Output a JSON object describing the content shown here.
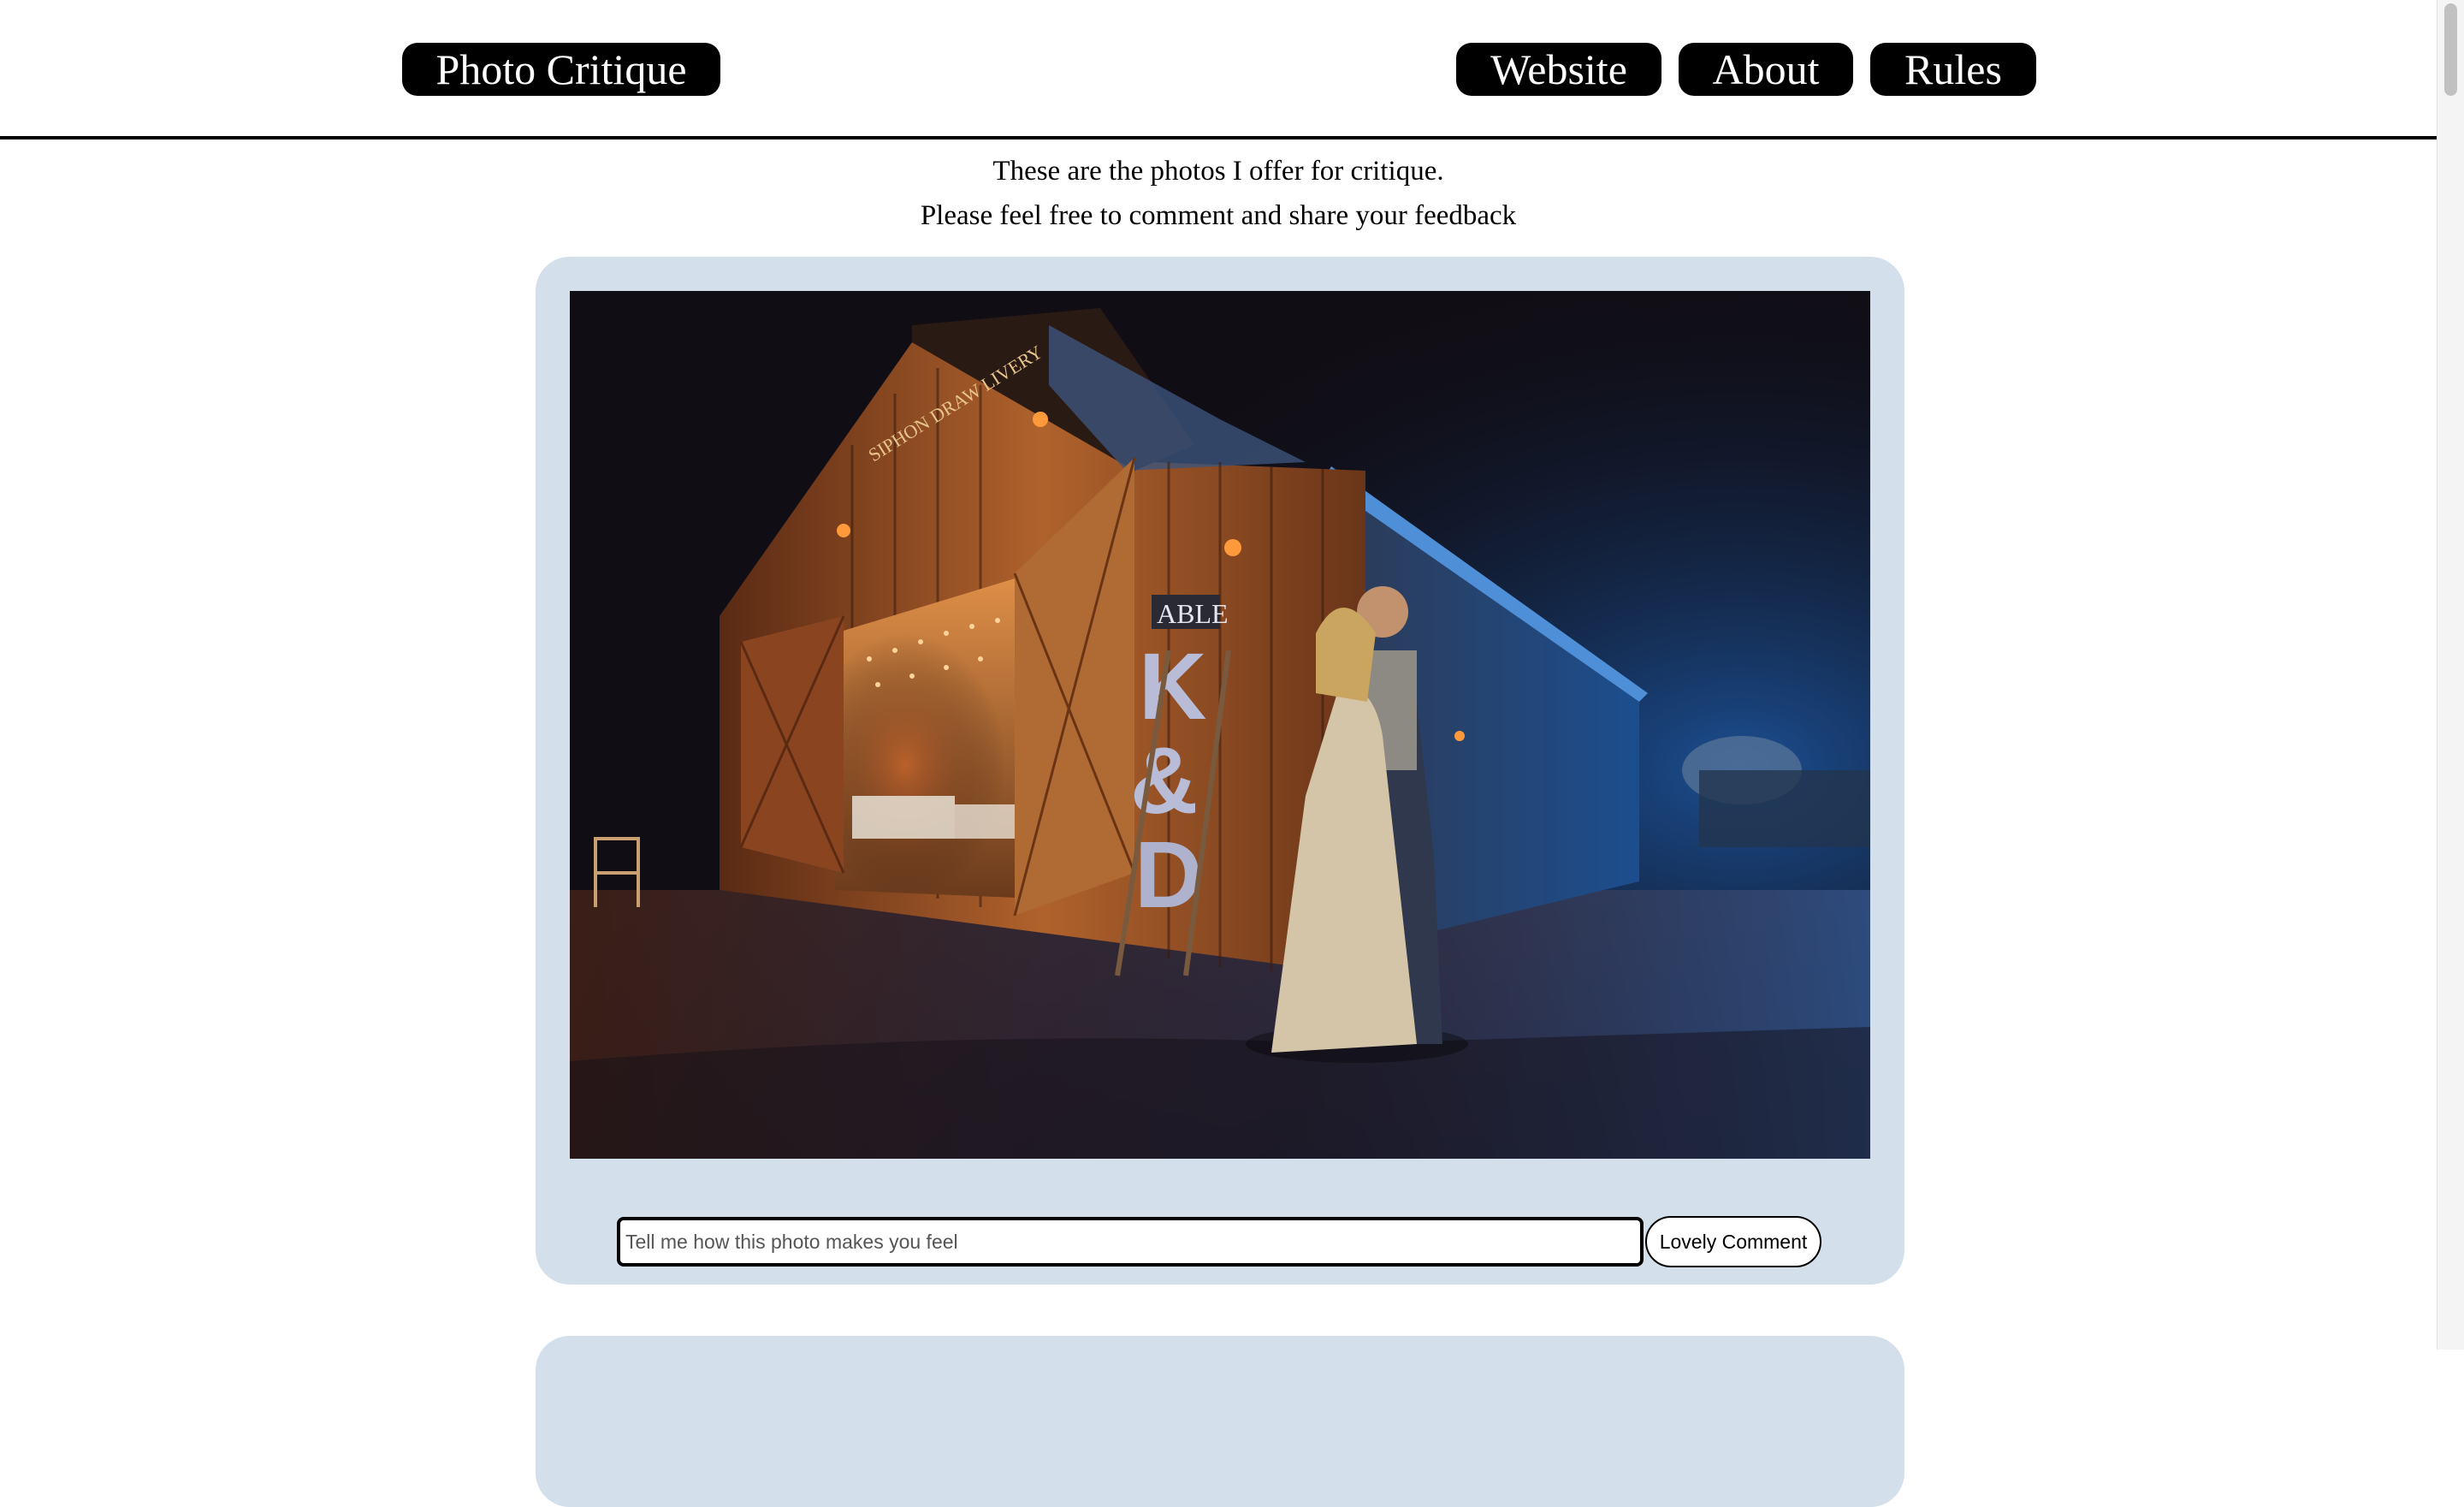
{
  "header": {
    "brand": "Photo Critique",
    "nav": {
      "website": "Website",
      "about": "About",
      "rules": "Rules"
    }
  },
  "intro": {
    "line1": "These are the photos I offer for critique.",
    "line2": "Please feel free to comment and share your feedback"
  },
  "posts": [
    {
      "photo": {
        "sign_text": "SIPHON DRAW LIVERY",
        "table_sign": "ABLE",
        "letters": "K & D"
      },
      "comment": {
        "placeholder": "Tell me how this photo makes you feel",
        "button_label": "Lovely Comment"
      }
    }
  ],
  "colors": {
    "card_bg": "#d4dfec",
    "pill_bg": "#000000",
    "page_bg": "#ffffff"
  }
}
